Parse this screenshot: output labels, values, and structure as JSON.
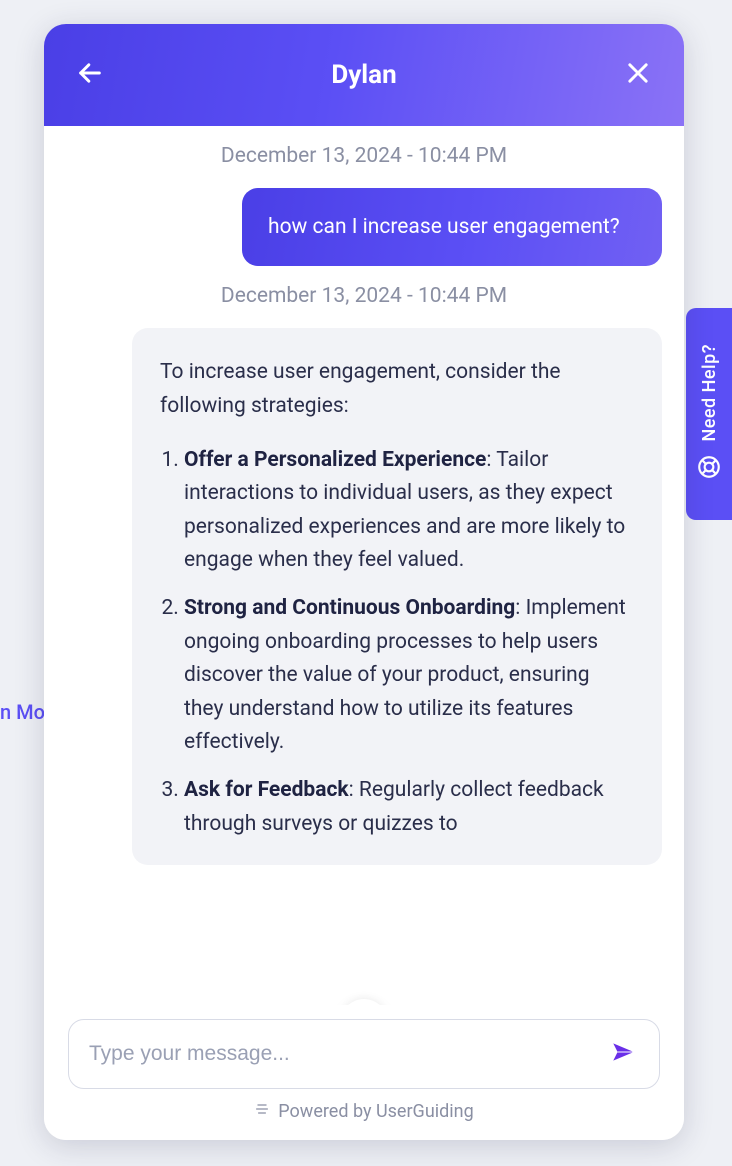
{
  "background": {
    "partial_text": "n Mo"
  },
  "help_tab": {
    "label": "Need Help?"
  },
  "chat": {
    "header": {
      "title": "Dylan"
    },
    "timestamps": {
      "user": "December 13, 2024 - 10:44 PM",
      "bot": "December 13, 2024 - 10:44 PM"
    },
    "user_message": "how can I increase user engagement?",
    "bot_message": {
      "intro": "To increase user engagement, consider the following strategies:",
      "items": [
        {
          "title": "Offer a Personalized Experience",
          "desc": ": Tailor interactions to individual users, as they expect personalized experiences and are more likely to engage when they feel valued."
        },
        {
          "title": "Strong and Continuous Onboarding",
          "desc": ": Implement ongoing onboarding processes to help users discover the value of your product, ensuring they understand how to utilize its features effectively."
        },
        {
          "title": "Ask for Feedback",
          "desc": ": Regularly collect feedback through surveys or quizzes to"
        }
      ]
    },
    "input": {
      "placeholder": "Type your message..."
    },
    "footer": {
      "powered": "Powered by UserGuiding"
    }
  }
}
